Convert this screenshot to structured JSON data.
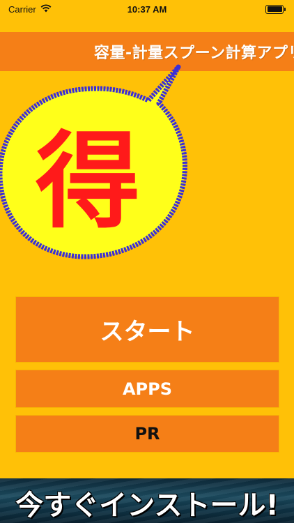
{
  "status_bar": {
    "carrier": "Carrier",
    "time": "10:37 AM",
    "wifi_icon": "wifi-icon",
    "battery_icon": "battery-icon"
  },
  "header": {
    "title": "容量-計量スプーン計算アプリ"
  },
  "promo": {
    "badge_char": "得",
    "bubble_fill": "#ffff1a",
    "bubble_stroke": "#3b2fd6",
    "char_color": "#ff1a1a"
  },
  "buttons": {
    "start_label": "スタート",
    "apps_label": "APPS",
    "pr_label": "PR"
  },
  "banner": {
    "text": "今すぐインストール!"
  },
  "colors": {
    "background": "#ffc107",
    "accent": "#f57f17"
  }
}
